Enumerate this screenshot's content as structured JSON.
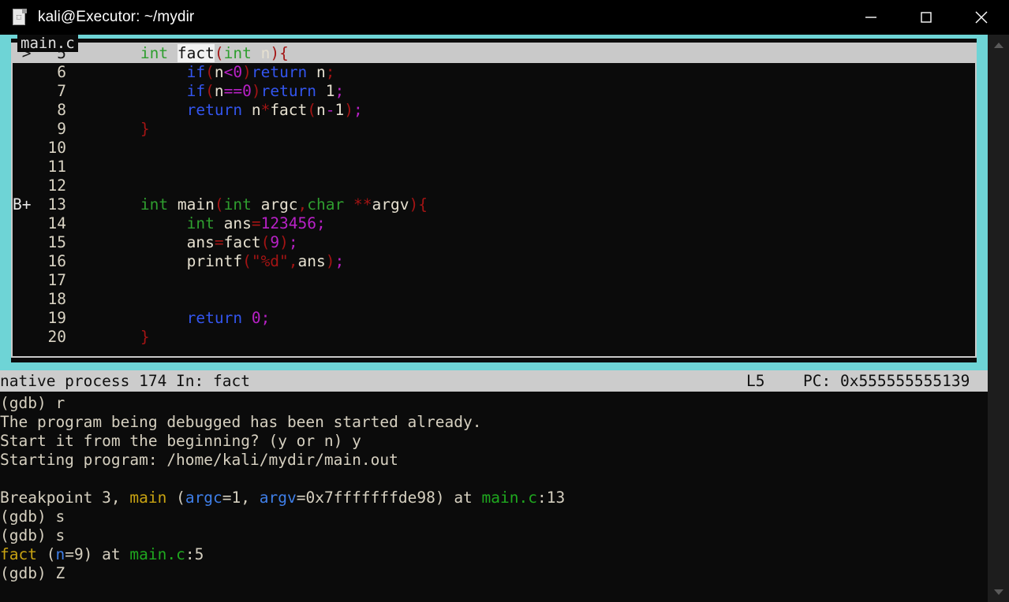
{
  "window": {
    "title": "kali@Executor: ~/mydir",
    "icon": "terminal-document-icon",
    "minimize_label": "Minimize",
    "maximize_label": "Maximize",
    "close_label": "Close"
  },
  "theme": {
    "accent_cyan": "#6ed4d6",
    "terminal_bg": "#0b0b0b",
    "status_bg": "#cccccc",
    "keyword_type": "#2f9e2f",
    "keyword_control": "#3355ee",
    "punctuation": "#a31414",
    "number": "#b821c6",
    "func_name": "#c8a312",
    "var_name": "#3f7fe8",
    "file_name": "#1fa81f"
  },
  "source_window": {
    "title": "main.c",
    "current_line": 5,
    "lines": [
      {
        "marker": "",
        "number": "5",
        "current": true,
        "indent": 8,
        "tokens": [
          {
            "t": "int",
            "c": "k"
          },
          {
            "t": " ",
            "c": "id"
          },
          {
            "t": "fact",
            "c": "cursorblk"
          },
          {
            "t": "(",
            "c": "pn"
          },
          {
            "t": "int",
            "c": "k"
          },
          {
            "t": " n",
            "c": "id"
          },
          {
            "t": ")",
            "c": "pn"
          },
          {
            "t": "{",
            "c": "pn"
          }
        ]
      },
      {
        "marker": "",
        "number": "6",
        "current": false,
        "indent": 13,
        "tokens": [
          {
            "t": "if",
            "c": "kw"
          },
          {
            "t": "(",
            "c": "pn"
          },
          {
            "t": "n",
            "c": "id"
          },
          {
            "t": "<",
            "c": "num"
          },
          {
            "t": "0",
            "c": "num"
          },
          {
            "t": ")",
            "c": "pn"
          },
          {
            "t": "return",
            "c": "kw"
          },
          {
            "t": " n",
            "c": "id"
          },
          {
            "t": ";",
            "c": "pn"
          }
        ]
      },
      {
        "marker": "",
        "number": "7",
        "current": false,
        "indent": 13,
        "tokens": [
          {
            "t": "if",
            "c": "kw"
          },
          {
            "t": "(",
            "c": "pn"
          },
          {
            "t": "n",
            "c": "id"
          },
          {
            "t": "==",
            "c": "num"
          },
          {
            "t": "0",
            "c": "num"
          },
          {
            "t": ")",
            "c": "pn"
          },
          {
            "t": "return",
            "c": "kw"
          },
          {
            "t": " ",
            "c": "id"
          },
          {
            "t": "1",
            "c": "id"
          },
          {
            "t": ";",
            "c": "num"
          }
        ]
      },
      {
        "marker": "",
        "number": "8",
        "current": false,
        "indent": 13,
        "tokens": [
          {
            "t": "return",
            "c": "kw"
          },
          {
            "t": " n",
            "c": "id"
          },
          {
            "t": "*",
            "c": "op"
          },
          {
            "t": "fact",
            "c": "id"
          },
          {
            "t": "(",
            "c": "pn"
          },
          {
            "t": "n",
            "c": "id"
          },
          {
            "t": "-",
            "c": "num"
          },
          {
            "t": "1",
            "c": "id"
          },
          {
            "t": ")",
            "c": "pn"
          },
          {
            "t": ";",
            "c": "num"
          }
        ]
      },
      {
        "marker": "",
        "number": "9",
        "current": false,
        "indent": 8,
        "tokens": [
          {
            "t": "}",
            "c": "pn"
          }
        ]
      },
      {
        "marker": "",
        "number": "10",
        "current": false,
        "indent": 0,
        "tokens": []
      },
      {
        "marker": "",
        "number": "11",
        "current": false,
        "indent": 0,
        "tokens": []
      },
      {
        "marker": "",
        "number": "12",
        "current": false,
        "indent": 0,
        "tokens": []
      },
      {
        "marker": "B+",
        "number": "13",
        "current": false,
        "indent": 8,
        "tokens": [
          {
            "t": "int",
            "c": "k"
          },
          {
            "t": " main",
            "c": "id"
          },
          {
            "t": "(",
            "c": "pn"
          },
          {
            "t": "int",
            "c": "k"
          },
          {
            "t": " argc",
            "c": "id"
          },
          {
            "t": ",",
            "c": "pn"
          },
          {
            "t": "char",
            "c": "k"
          },
          {
            "t": " ",
            "c": "id"
          },
          {
            "t": "**",
            "c": "op"
          },
          {
            "t": "argv",
            "c": "id"
          },
          {
            "t": ")",
            "c": "pn"
          },
          {
            "t": "{",
            "c": "pn"
          }
        ]
      },
      {
        "marker": "",
        "number": "14",
        "current": false,
        "indent": 13,
        "tokens": [
          {
            "t": "int",
            "c": "k"
          },
          {
            "t": " ans",
            "c": "id"
          },
          {
            "t": "=",
            "c": "op"
          },
          {
            "t": "123456",
            "c": "num"
          },
          {
            "t": ";",
            "c": "num"
          }
        ]
      },
      {
        "marker": "",
        "number": "15",
        "current": false,
        "indent": 13,
        "tokens": [
          {
            "t": "ans",
            "c": "id"
          },
          {
            "t": "=",
            "c": "op"
          },
          {
            "t": "fact",
            "c": "id"
          },
          {
            "t": "(",
            "c": "pn"
          },
          {
            "t": "9",
            "c": "num"
          },
          {
            "t": ")",
            "c": "pn"
          },
          {
            "t": ";",
            "c": "num"
          }
        ]
      },
      {
        "marker": "",
        "number": "16",
        "current": false,
        "indent": 13,
        "tokens": [
          {
            "t": "printf",
            "c": "id"
          },
          {
            "t": "(",
            "c": "pn"
          },
          {
            "t": "\"%d\"",
            "c": "pn"
          },
          {
            "t": ",",
            "c": "pn"
          },
          {
            "t": "ans",
            "c": "id"
          },
          {
            "t": ")",
            "c": "pn"
          },
          {
            "t": ";",
            "c": "num"
          }
        ]
      },
      {
        "marker": "",
        "number": "17",
        "current": false,
        "indent": 0,
        "tokens": []
      },
      {
        "marker": "",
        "number": "18",
        "current": false,
        "indent": 0,
        "tokens": []
      },
      {
        "marker": "",
        "number": "19",
        "current": false,
        "indent": 13,
        "tokens": [
          {
            "t": "return",
            "c": "kw"
          },
          {
            "t": " ",
            "c": "id"
          },
          {
            "t": "0",
            "c": "num"
          },
          {
            "t": ";",
            "c": "num"
          }
        ]
      },
      {
        "marker": "",
        "number": "20",
        "current": false,
        "indent": 8,
        "tokens": [
          {
            "t": "}",
            "c": "pn"
          }
        ]
      }
    ]
  },
  "status_bar": {
    "left": "native process 174 In: fact",
    "line": "L5",
    "pc_label": "PC: 0x555555555139"
  },
  "console": {
    "rows": [
      [
        {
          "t": "(gdb) r",
          "c": "t-plain"
        }
      ],
      [
        {
          "t": "The program being debugged has been started already.",
          "c": "t-plain"
        }
      ],
      [
        {
          "t": "Start it from the beginning? (y or n) y",
          "c": "t-plain"
        }
      ],
      [
        {
          "t": "Starting program: /home/kali/mydir/main.out",
          "c": "t-plain"
        }
      ],
      [
        {
          "t": "",
          "c": "t-plain"
        }
      ],
      [
        {
          "t": "Breakpoint 3, ",
          "c": "t-plain"
        },
        {
          "t": "main",
          "c": "t-func"
        },
        {
          "t": " (",
          "c": "t-plain"
        },
        {
          "t": "argc",
          "c": "t-var"
        },
        {
          "t": "=1, ",
          "c": "t-plain"
        },
        {
          "t": "argv",
          "c": "t-var"
        },
        {
          "t": "=0x7fffffffde98) at ",
          "c": "t-plain"
        },
        {
          "t": "main.c",
          "c": "t-file"
        },
        {
          "t": ":13",
          "c": "t-plain"
        }
      ],
      [
        {
          "t": "(gdb) s",
          "c": "t-plain"
        }
      ],
      [
        {
          "t": "(gdb) s",
          "c": "t-plain"
        }
      ],
      [
        {
          "t": "fact",
          "c": "t-func"
        },
        {
          "t": " (",
          "c": "t-plain"
        },
        {
          "t": "n",
          "c": "t-var"
        },
        {
          "t": "=9) at ",
          "c": "t-plain"
        },
        {
          "t": "main.c",
          "c": "t-file"
        },
        {
          "t": ":5",
          "c": "t-plain"
        }
      ],
      [
        {
          "t": "(gdb) Z",
          "c": "t-plain"
        }
      ]
    ]
  },
  "scrollbar": {
    "up_label": "Scroll up",
    "down_label": "Scroll down",
    "thumb_label": "Scroll thumb"
  }
}
